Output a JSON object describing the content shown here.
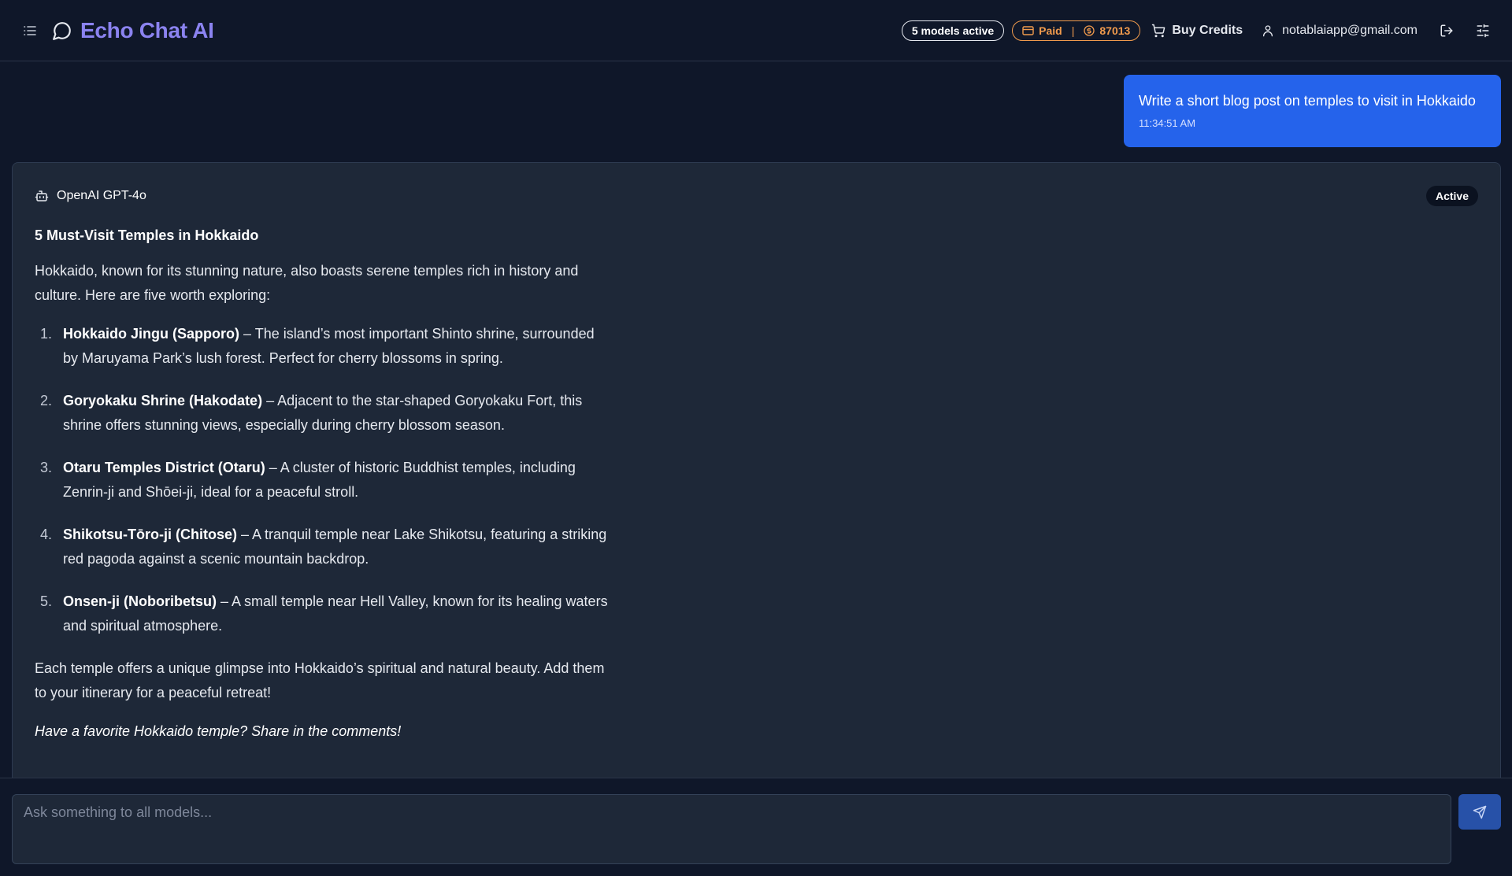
{
  "app": {
    "title": "Echo Chat AI"
  },
  "header": {
    "models_active": "5 models active",
    "plan_label": "Paid",
    "credits": "87013",
    "buy_credits": "Buy Credits",
    "user_email": "notablaiapp@gmail.com"
  },
  "user_message": {
    "text": "Write a short blog post on temples to visit in Hokkaido",
    "time": "11:34:51 AM"
  },
  "response": {
    "model": "OpenAI GPT-4o",
    "status": "Active",
    "heading": "5 Must-Visit Temples in Hokkaido",
    "intro": "Hokkaido, known for its stunning nature, also boasts serene temples rich in history and culture. Here are five worth exploring:",
    "items": [
      {
        "num": "1.",
        "name": "Hokkaido Jingu (Sapporo)",
        "desc": " – The island’s most important Shinto shrine, surrounded by Maruyama Park’s lush forest. Perfect for cherry blossoms in spring."
      },
      {
        "num": "2.",
        "name": "Goryokaku Shrine (Hakodate)",
        "desc": " – Adjacent to the star-shaped Goryokaku Fort, this shrine offers stunning views, especially during cherry blossom season."
      },
      {
        "num": "3.",
        "name": "Otaru Temples District (Otaru)",
        "desc": " – A cluster of historic Buddhist temples, including Zenrin-ji and Shōei-ji, ideal for a peaceful stroll."
      },
      {
        "num": "4.",
        "name": "Shikotsu-Tōro-ji (Chitose)",
        "desc": " – A tranquil temple near Lake Shikotsu, featuring a striking red pagoda against a scenic mountain backdrop."
      },
      {
        "num": "5.",
        "name": "Onsen-ji (Noboribetsu)",
        "desc": " – A small temple near Hell Valley, known for its healing waters and spiritual atmosphere."
      }
    ],
    "outro": "Each temple offers a unique glimpse into Hokkaido’s spiritual and natural beauty. Add them to your itinerary for a peaceful retreat!",
    "closing": "Have a favorite Hokkaido temple? Share in the comments!"
  },
  "composer": {
    "placeholder": "Ask something to all models..."
  },
  "icons": {
    "menu": "list-icon",
    "brand": "chat-bubble-icon",
    "plan": "credit-card-icon",
    "credits": "coin-icon",
    "cart": "cart-icon",
    "user": "user-icon",
    "logout": "logout-icon",
    "settings": "sliders-icon",
    "bot": "bot-icon",
    "send": "send-icon"
  },
  "colors": {
    "background": "#0f1729",
    "card": "#1e2838",
    "brand": "#8b83f0",
    "user_bubble": "#2563eb",
    "paid_accent": "#f19b4d",
    "send_button": "#2751a8"
  }
}
